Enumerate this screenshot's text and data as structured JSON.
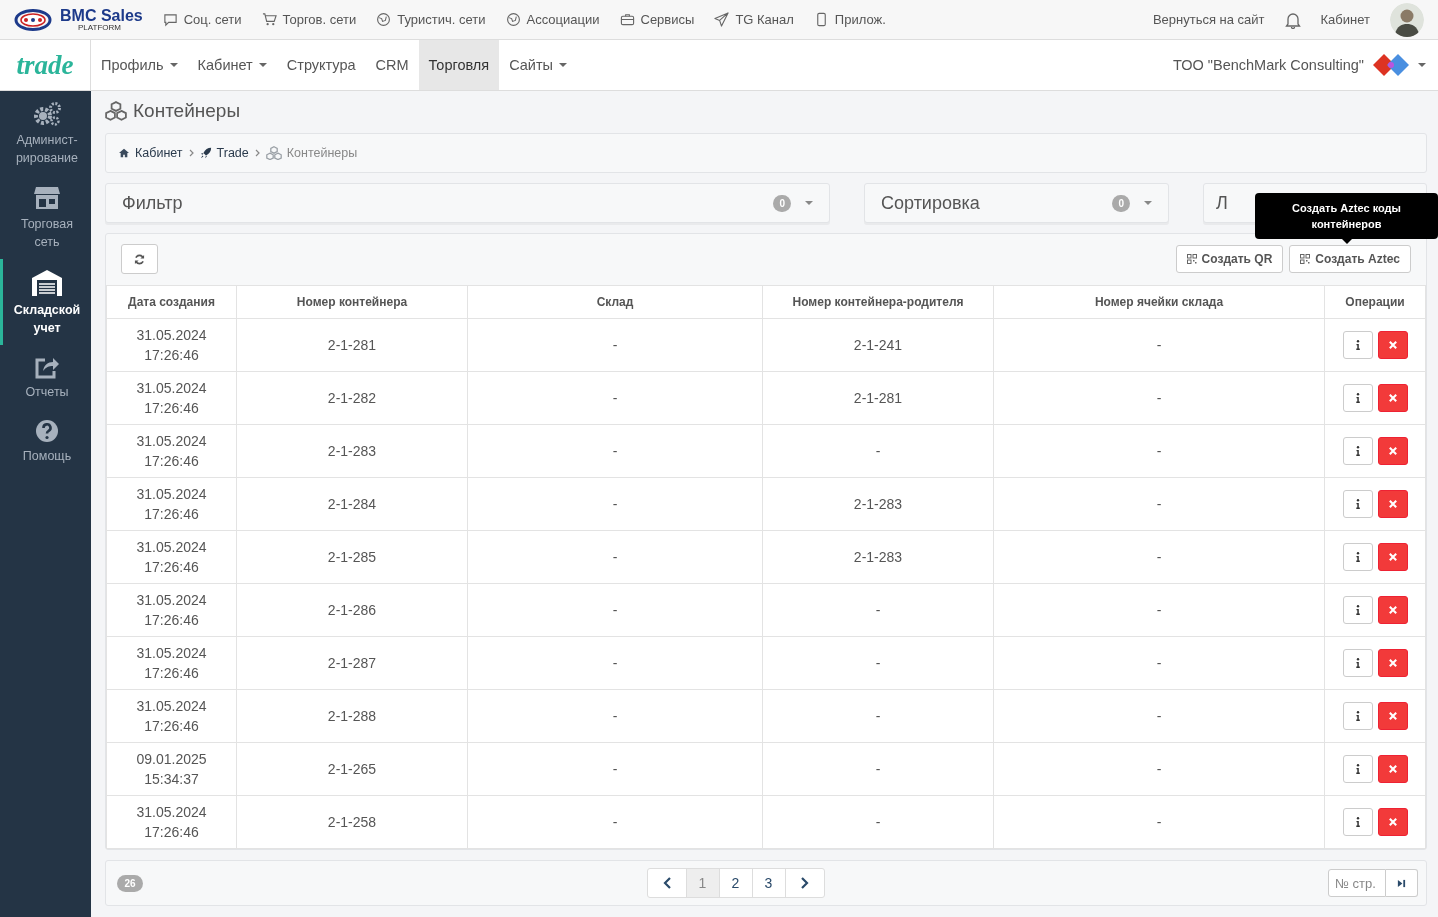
{
  "topbar": {
    "brand": "BMC Sales",
    "brand_sub": "PLATFORM",
    "links": [
      {
        "label": "Соц. сети",
        "kind": "chat"
      },
      {
        "label": "Торгов. сети",
        "kind": "cart"
      },
      {
        "label": "Туристич. сети",
        "kind": "globe"
      },
      {
        "label": "Ассоциации",
        "kind": "globe"
      },
      {
        "label": "Сервисы",
        "kind": "briefcase"
      },
      {
        "label": "TG Канал",
        "kind": "send"
      },
      {
        "label": "Прилож.",
        "kind": "phone"
      }
    ],
    "back_link": "Вернуться на сайт",
    "cabinet": "Кабинет"
  },
  "nav": {
    "logo": "trade",
    "items": [
      {
        "label": "Профиль",
        "dropdown": true,
        "selected": false
      },
      {
        "label": "Кабинет",
        "dropdown": true,
        "selected": false
      },
      {
        "label": "Структура",
        "dropdown": false,
        "selected": false
      },
      {
        "label": "CRM",
        "dropdown": false,
        "selected": false
      },
      {
        "label": "Торговля",
        "dropdown": false,
        "selected": true
      },
      {
        "label": "Сайты",
        "dropdown": true,
        "selected": false
      }
    ],
    "company": "ТОО \"BenchMark Consulting\""
  },
  "sidebar": {
    "items": [
      {
        "label": "Админист-рирование",
        "kind": "gears",
        "selected": false
      },
      {
        "label": "Торговая сеть",
        "kind": "store",
        "selected": false
      },
      {
        "label": "Складской учет",
        "kind": "warehouse",
        "selected": true
      },
      {
        "label": "Отчеты",
        "kind": "share",
        "selected": false
      },
      {
        "label": "Помощь",
        "kind": "help",
        "selected": false
      }
    ]
  },
  "page_title": "Контейнеры",
  "breadcrumbs": [
    {
      "label": "Кабинет",
      "kind": "home",
      "current": false
    },
    {
      "label": "Trade",
      "kind": "rocket",
      "current": false
    },
    {
      "label": "Контейнеры",
      "kind": "cubes",
      "current": true
    }
  ],
  "panels": [
    {
      "label": "Фильтр",
      "count": "0"
    },
    {
      "label": "Сортировка",
      "count": "0"
    }
  ],
  "third_panel_label": "Л",
  "toolbar": {
    "buttons": [
      "Создать QR",
      "Создать Aztec"
    ],
    "tooltip": "Создать Aztec коды контейнеров"
  },
  "table": {
    "columns": [
      "Дата создания",
      "Номер контейнера",
      "Склад",
      "Номер контейнера-родителя",
      "Номер ячейки склада",
      "Операции"
    ],
    "rows": [
      {
        "created": "31.05.2024 17:26:46",
        "number": "2-1-281",
        "warehouse": "-",
        "parent": "2-1-241",
        "cell": "-"
      },
      {
        "created": "31.05.2024 17:26:46",
        "number": "2-1-282",
        "warehouse": "-",
        "parent": "2-1-281",
        "cell": "-"
      },
      {
        "created": "31.05.2024 17:26:46",
        "number": "2-1-283",
        "warehouse": "-",
        "parent": "-",
        "cell": "-"
      },
      {
        "created": "31.05.2024 17:26:46",
        "number": "2-1-284",
        "warehouse": "-",
        "parent": "2-1-283",
        "cell": "-"
      },
      {
        "created": "31.05.2024 17:26:46",
        "number": "2-1-285",
        "warehouse": "-",
        "parent": "2-1-283",
        "cell": "-"
      },
      {
        "created": "31.05.2024 17:26:46",
        "number": "2-1-286",
        "warehouse": "-",
        "parent": "-",
        "cell": "-"
      },
      {
        "created": "31.05.2024 17:26:46",
        "number": "2-1-287",
        "warehouse": "-",
        "parent": "-",
        "cell": "-"
      },
      {
        "created": "31.05.2024 17:26:46",
        "number": "2-1-288",
        "warehouse": "-",
        "parent": "-",
        "cell": "-"
      },
      {
        "created": "09.01.2025 15:34:37",
        "number": "2-1-265",
        "warehouse": "-",
        "parent": "-",
        "cell": "-"
      },
      {
        "created": "31.05.2024 17:26:46",
        "number": "2-1-258",
        "warehouse": "-",
        "parent": "-",
        "cell": "-"
      }
    ]
  },
  "footer": {
    "total": "26",
    "pages": [
      {
        "label": "1",
        "selected": true
      },
      {
        "label": "2",
        "selected": false
      },
      {
        "label": "3",
        "selected": false
      }
    ],
    "page_input_placeholder": "№ стр."
  }
}
